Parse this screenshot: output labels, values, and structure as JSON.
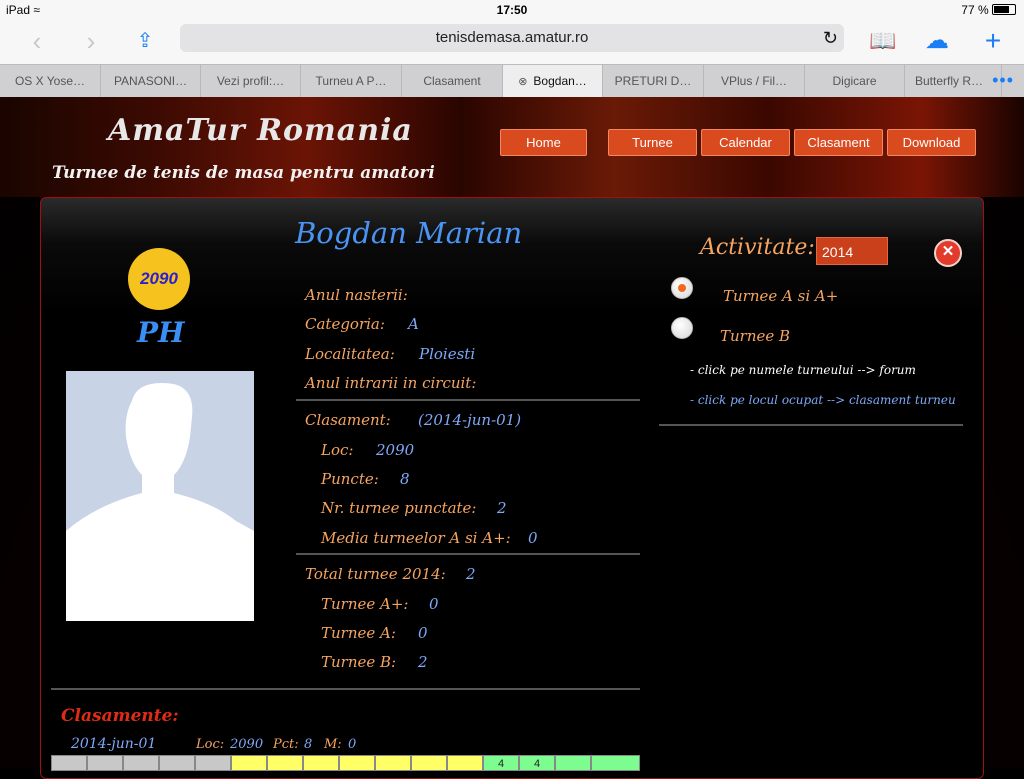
{
  "status": {
    "device": "iPad",
    "time": "17:50",
    "battery": "77 %"
  },
  "browser": {
    "url": "tenisdemasa.amatur.ro",
    "tabs": [
      "OS X Yose…",
      "PANASONI…",
      "Vezi profil:…",
      "Turneu A P…",
      "Clasament",
      "Bogdan…",
      "PRETURI D…",
      "VPlus / Fil…",
      "Digicare",
      "Butterfly R…"
    ],
    "active_tab": 5
  },
  "site": {
    "title": "AmaTur Romania",
    "subtitle": "Turnee de tenis de masa pentru amatori",
    "nav": [
      "Home",
      "Turnee",
      "Calendar",
      "Clasament",
      "Download"
    ]
  },
  "player": {
    "name": "Bogdan Marian",
    "rank_badge": "2090",
    "county": "PH",
    "fields": {
      "birth_label": "Anul nasterii:",
      "category_label": "Categoria:",
      "category": "A",
      "city_label": "Localitatea:",
      "city": "Ploiesti",
      "circuit_label": "Anul intrarii in circuit:"
    },
    "ranking": {
      "label": "Clasament:",
      "date": "(2014-jun-01)",
      "loc_label": "Loc:",
      "loc": "2090",
      "points_label": "Puncte:",
      "points": "8",
      "tour_count_label": "Nr. turnee punctate:",
      "tour_count": "2",
      "media_label": "Media turneelor A si A+:",
      "media": "0"
    },
    "totals": {
      "label": "Total turnee 2014:",
      "total": "2",
      "aplus_label": "Turnee A+:",
      "aplus": "0",
      "a_label": "Turnee A:",
      "a": "0",
      "b_label": "Turnee B:",
      "b": "2"
    }
  },
  "activity": {
    "label": "Activitate:",
    "year": "2014",
    "options": [
      "Turnee A si A+",
      "Turnee B"
    ],
    "selected": 0,
    "hint_forum": "- click pe numele turneului --> forum",
    "hint_rank": "- click pe locul ocupat --> clasament turneu"
  },
  "rankings": {
    "title": "Clasamente:",
    "date": "2014-jun-01",
    "loc_label": "Loc:",
    "loc": "2090",
    "pct_label": "Pct:",
    "pct": "8",
    "m_label": "M:",
    "m": "0",
    "cells": [
      "",
      "",
      "",
      "",
      "",
      "",
      "",
      "",
      "",
      "",
      "",
      "",
      "4",
      "4",
      "",
      "",
      ""
    ]
  },
  "colors": {
    "nav_bg": "#d94a1f",
    "label": "#f6a460",
    "value": "#7fa8f7",
    "title_blue": "#4a94f4",
    "accent_red": "#e22b14",
    "badge": "#f6c21d"
  }
}
